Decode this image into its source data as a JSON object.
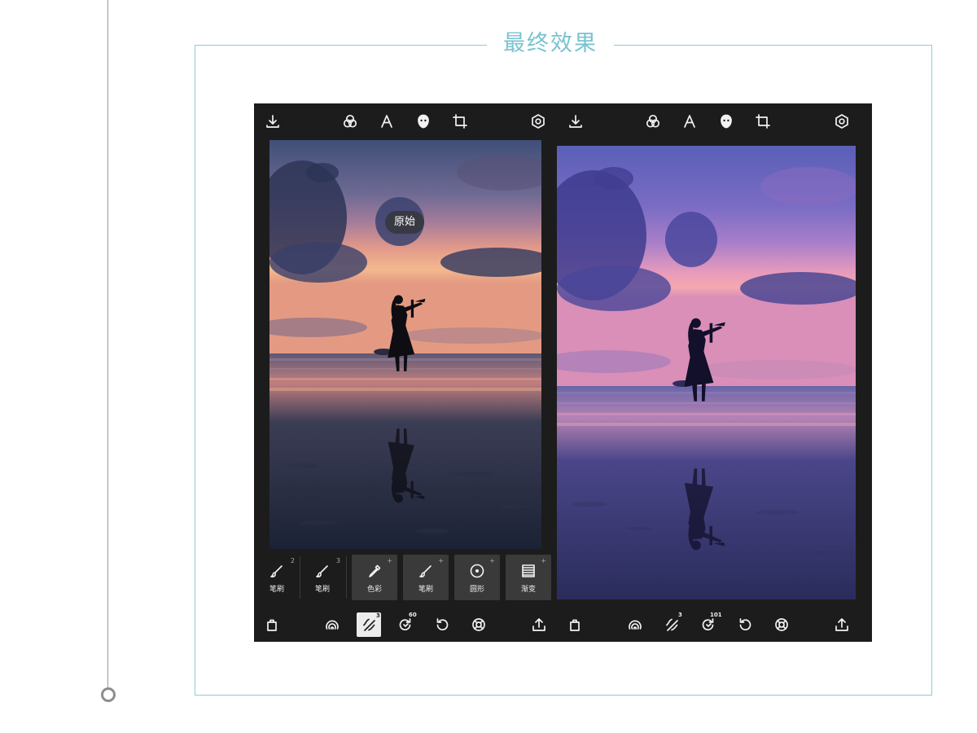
{
  "heading": {
    "title": "最终效果"
  },
  "original_tooltip": "原始",
  "tools": [
    {
      "label": "笔刷",
      "number": "2",
      "icon": "brush-icon"
    },
    {
      "label": "笔刷",
      "number": "3",
      "icon": "brush-icon"
    },
    {
      "label": "色彩",
      "number": "+",
      "icon": "eyedropper-icon"
    },
    {
      "label": "笔刷",
      "number": "+",
      "icon": "brush-icon"
    },
    {
      "label": "圆形",
      "number": "+",
      "icon": "circle-icon"
    },
    {
      "label": "渐变",
      "number": "+",
      "icon": "gradient-icon"
    }
  ],
  "left_badges": {
    "heal": "3",
    "redo": "60"
  },
  "right_badges": {
    "heal": "3",
    "redo": "101"
  },
  "top_icons": [
    "download-icon",
    "filters-icon",
    "text-icon",
    "face-icon",
    "crop-icon",
    "settings-icon"
  ],
  "bottom_icons": [
    "bag-icon",
    "spiral-icon",
    "heal-icon",
    "redo-icon",
    "undo-icon",
    "lifebuoy-icon",
    "share-icon"
  ],
  "colors": {
    "accent": "#79c3d0",
    "toolbar_bg": "#1c1c1c",
    "frame_border": "#8ccbd8"
  }
}
